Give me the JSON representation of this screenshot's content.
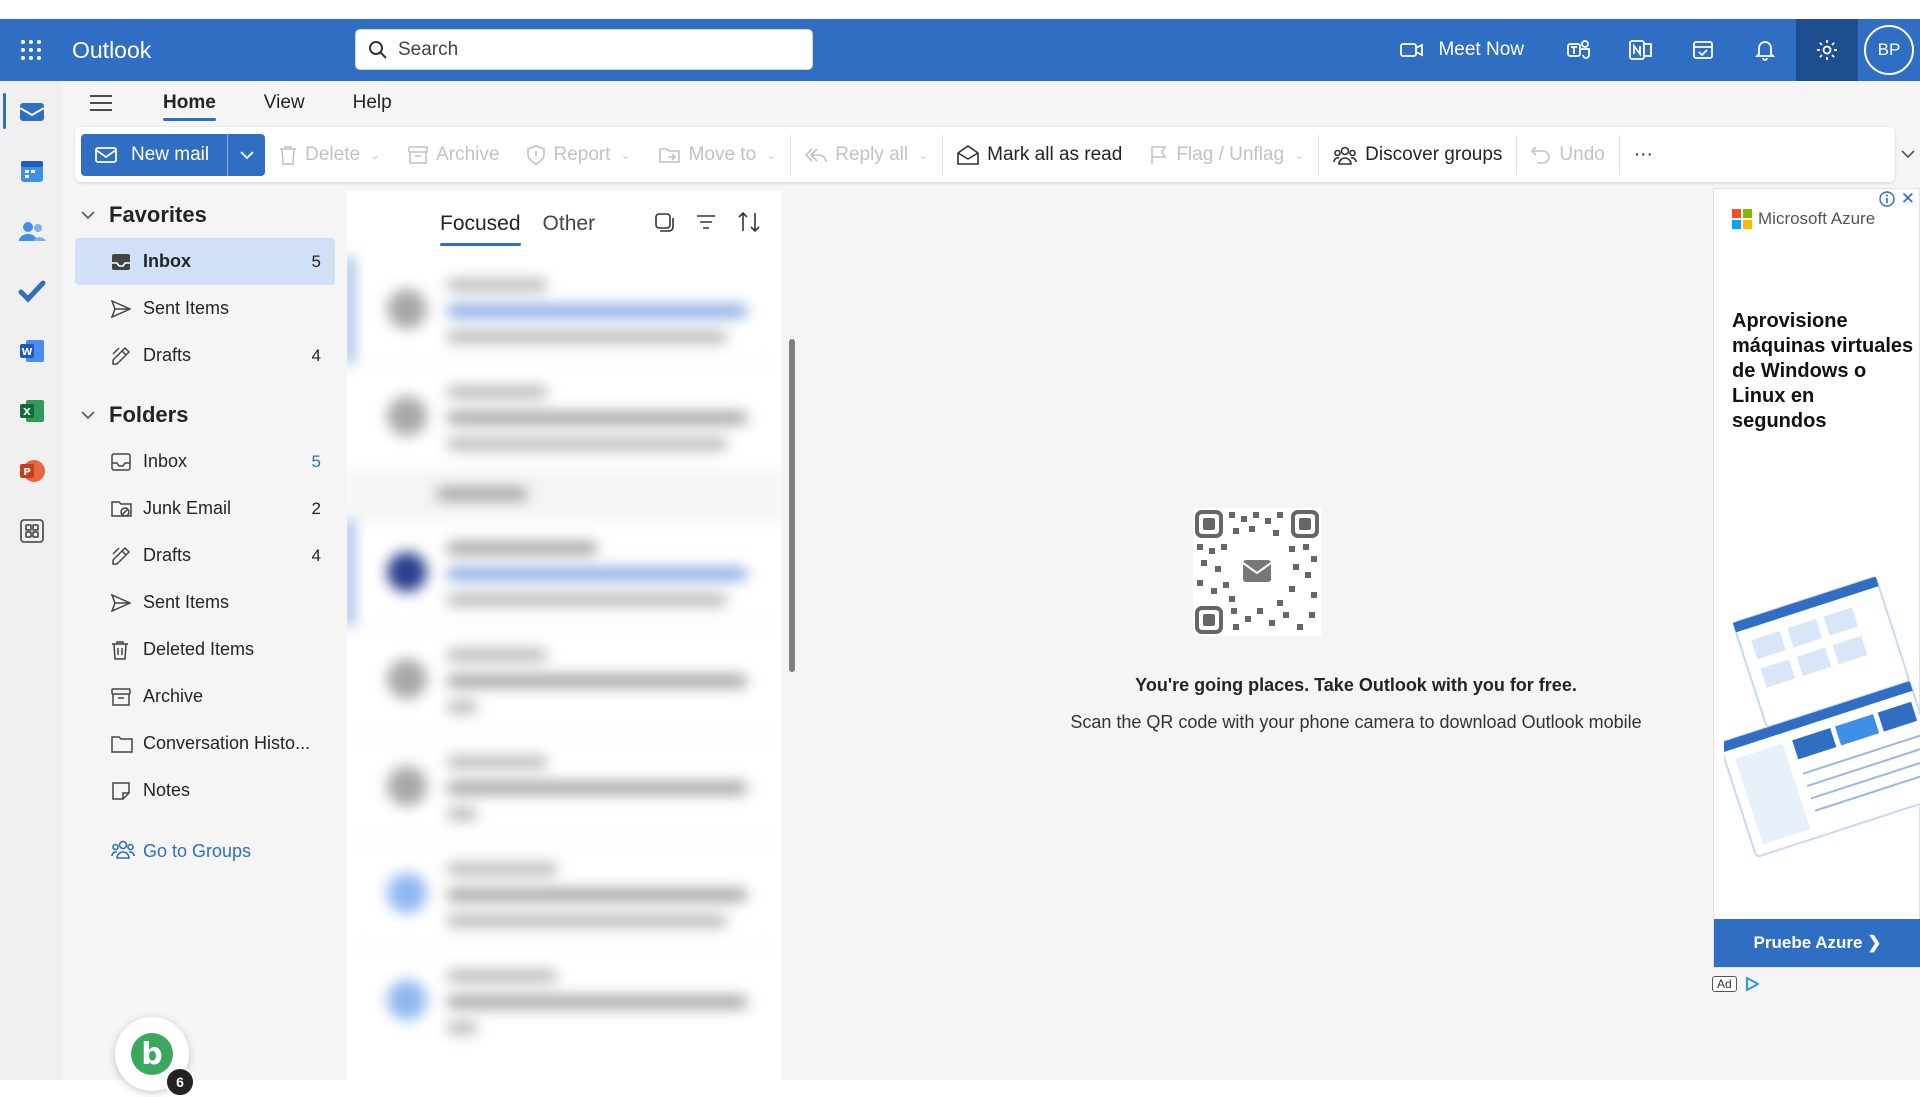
{
  "app": {
    "title": "Outlook"
  },
  "search": {
    "placeholder": "Search"
  },
  "header": {
    "meet_now": "Meet Now",
    "avatar_initials": "BP"
  },
  "tabs": {
    "home": "Home",
    "view": "View",
    "help": "Help"
  },
  "ribbon": {
    "new_mail": "New mail",
    "delete": "Delete",
    "archive": "Archive",
    "report": "Report",
    "move_to": "Move to",
    "reply_all": "Reply all",
    "mark_all_read": "Mark all as read",
    "flag_unflag": "Flag / Unflag",
    "discover_groups": "Discover groups",
    "undo": "Undo",
    "more": "···"
  },
  "nav": {
    "favorites_title": "Favorites",
    "favorites": [
      {
        "label": "Inbox",
        "count": "5",
        "icon": "inbox-icon"
      },
      {
        "label": "Sent Items",
        "count": "",
        "icon": "send-icon"
      },
      {
        "label": "Drafts",
        "count": "4",
        "icon": "drafts-icon"
      }
    ],
    "folders_title": "Folders",
    "folders": [
      {
        "label": "Inbox",
        "count": "5",
        "icon": "inbox-icon"
      },
      {
        "label": "Junk Email",
        "count": "2",
        "icon": "junk-icon"
      },
      {
        "label": "Drafts",
        "count": "4",
        "icon": "drafts-icon"
      },
      {
        "label": "Sent Items",
        "count": "",
        "icon": "send-icon"
      },
      {
        "label": "Deleted Items",
        "count": "",
        "icon": "trash-icon"
      },
      {
        "label": "Archive",
        "count": "",
        "icon": "archive-icon"
      },
      {
        "label": "Conversation Histo...",
        "count": "",
        "icon": "folder-icon"
      },
      {
        "label": "Notes",
        "count": "",
        "icon": "notes-icon"
      }
    ],
    "go_to_groups": "Go to Groups"
  },
  "message_list": {
    "focused": "Focused",
    "other": "Other"
  },
  "reading_pane": {
    "promo_title": "You're going places. Take Outlook with you for free.",
    "promo_text": "Scan the QR code with your phone camera to download Outlook mobile"
  },
  "ad": {
    "brand": "Microsoft Azure",
    "headline": "Aprovisione máquinas virtuales de Windows o Linux en segundos",
    "cta": "Pruebe Azure ❯",
    "label": "Ad"
  },
  "bing_chat": {
    "letter": "b",
    "badge": "6"
  },
  "colors": {
    "accent": "#2f6ec2",
    "header_bg": "#2f6ec2",
    "selected_bg": "#cfe0f7"
  }
}
